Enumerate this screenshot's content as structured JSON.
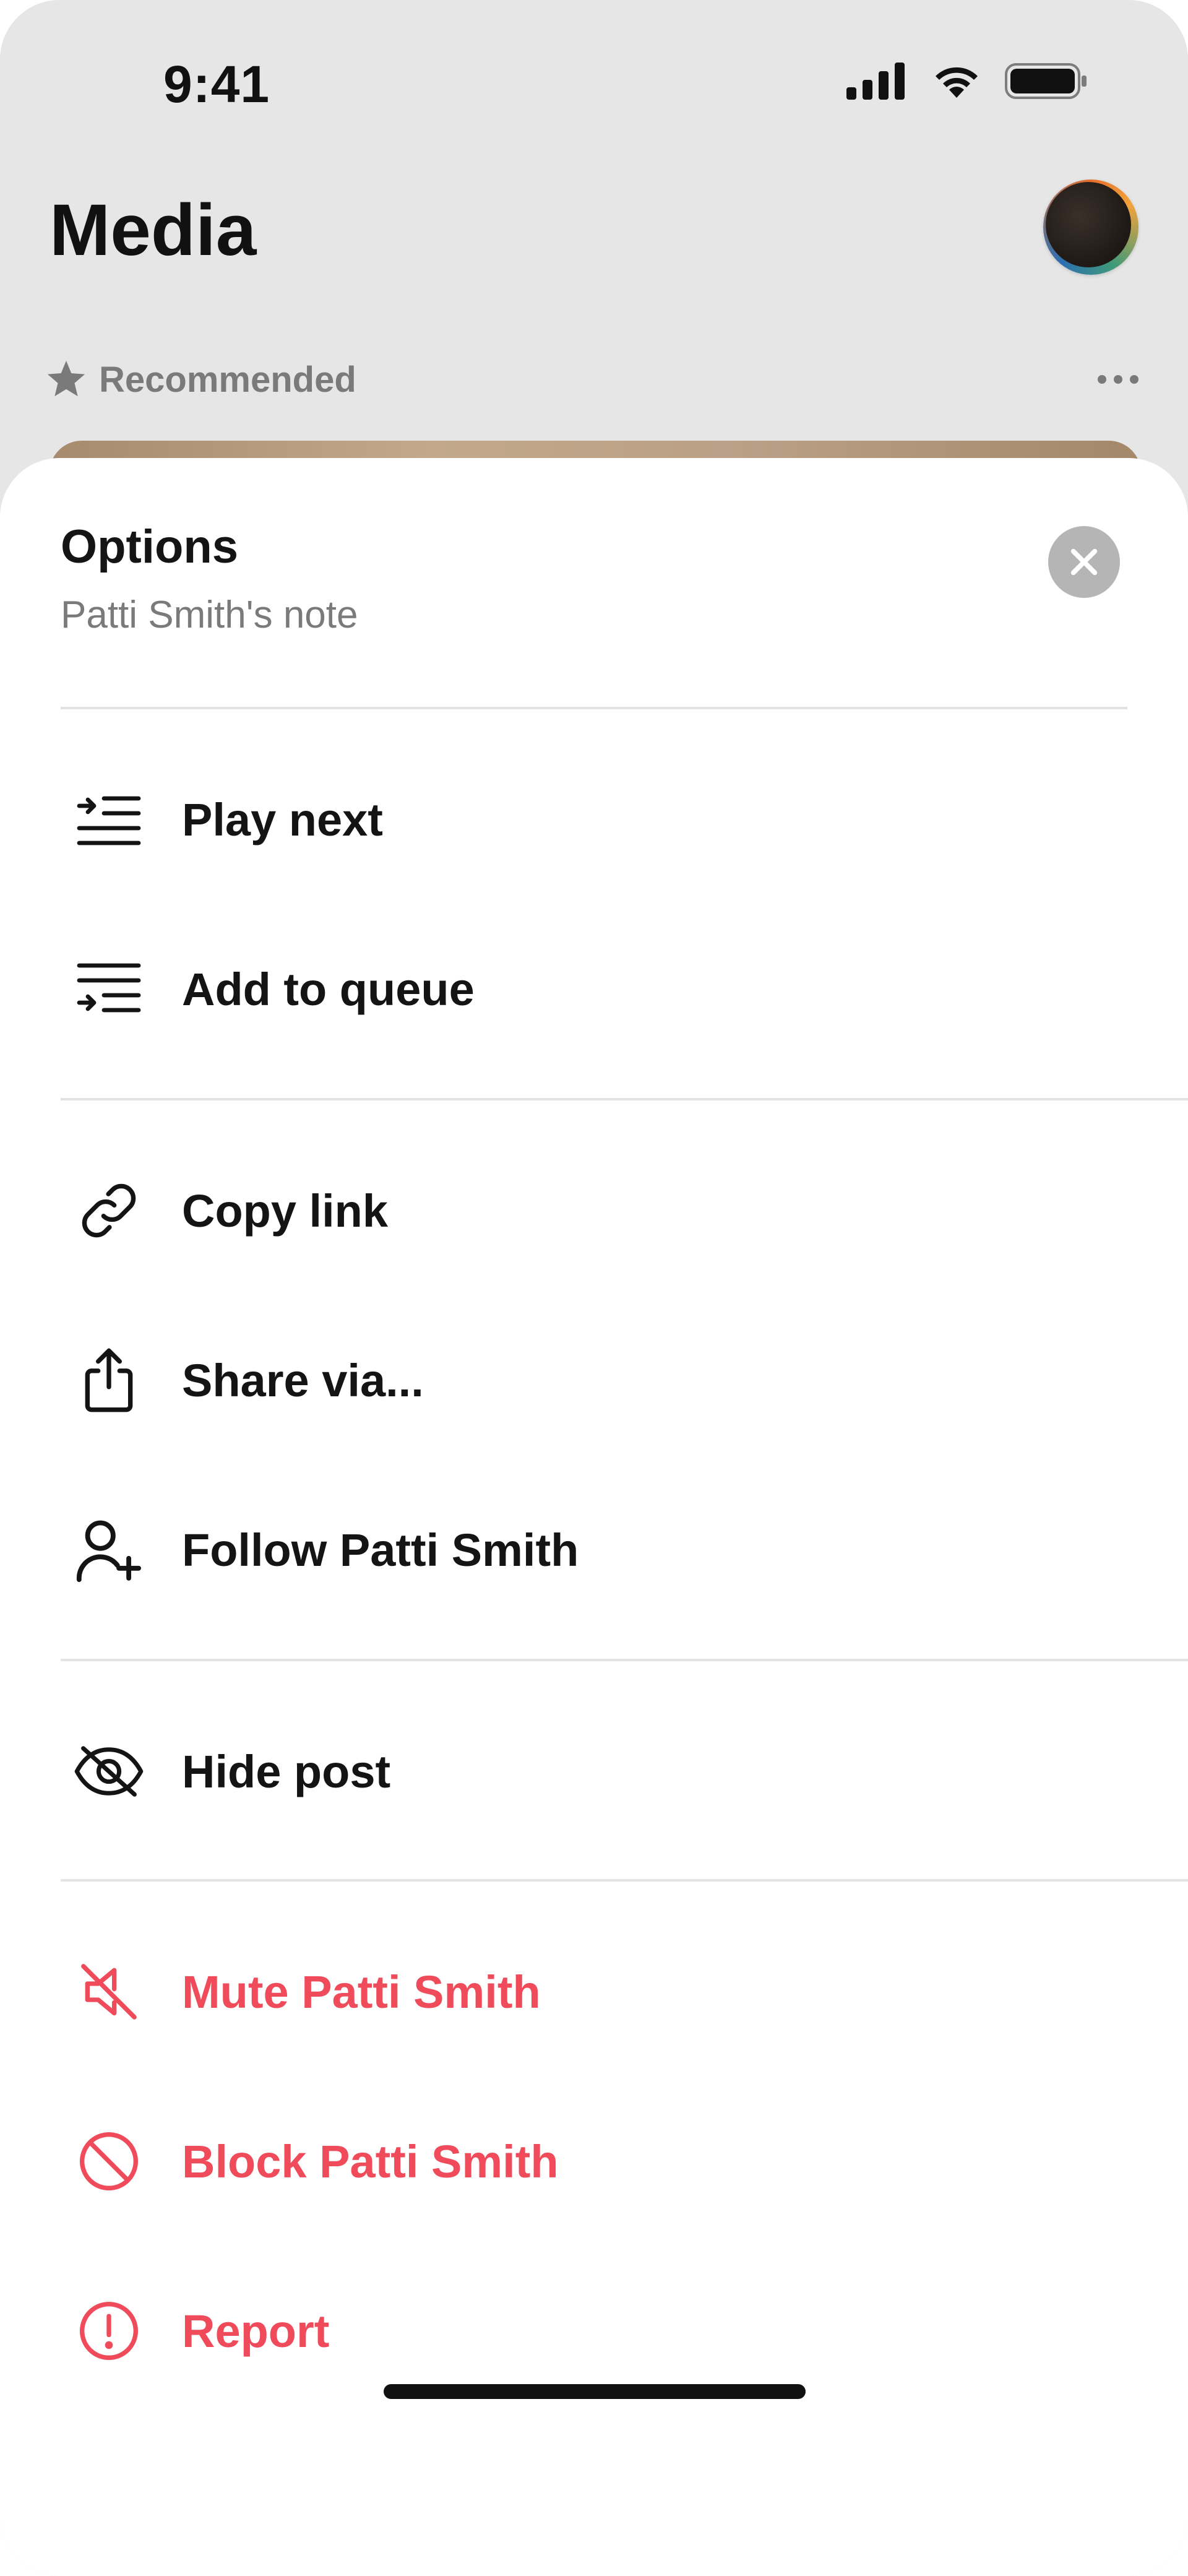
{
  "status_bar": {
    "time": "9:41",
    "icons": [
      "cellular-signal-icon",
      "wifi-icon",
      "battery-icon"
    ]
  },
  "header": {
    "title": "Media",
    "avatar": "profile-avatar"
  },
  "feed": {
    "section_label": "Recommended",
    "section_icon": "star-icon",
    "more_icon": "more-icon"
  },
  "sheet": {
    "title": "Options",
    "subtitle": "Patti Smith's note",
    "close_icon": "close-icon",
    "groups": [
      [
        {
          "label": "Play next",
          "icon": "play-next-icon",
          "danger": false
        },
        {
          "label": "Add to queue",
          "icon": "add-to-queue-icon",
          "danger": false
        }
      ],
      [
        {
          "label": "Copy link",
          "icon": "link-icon",
          "danger": false
        },
        {
          "label": "Share via...",
          "icon": "share-icon",
          "danger": false
        },
        {
          "label": "Follow Patti Smith",
          "icon": "follow-user-icon",
          "danger": false
        }
      ],
      [
        {
          "label": "Hide post",
          "icon": "hide-eye-icon",
          "danger": false
        }
      ],
      [
        {
          "label": "Mute Patti Smith",
          "icon": "mute-icon",
          "danger": true
        },
        {
          "label": "Block Patti Smith",
          "icon": "block-icon",
          "danger": true
        },
        {
          "label": "Report",
          "icon": "report-icon",
          "danger": true
        }
      ]
    ]
  },
  "colors": {
    "background_app": "#e6e6e6",
    "sheet": "#ffffff",
    "text_primary": "#141414",
    "text_secondary": "#7a7a7a",
    "danger": "#ef4b5a",
    "divider": "#e3e3e3",
    "close_button": "#b5b5b5"
  }
}
